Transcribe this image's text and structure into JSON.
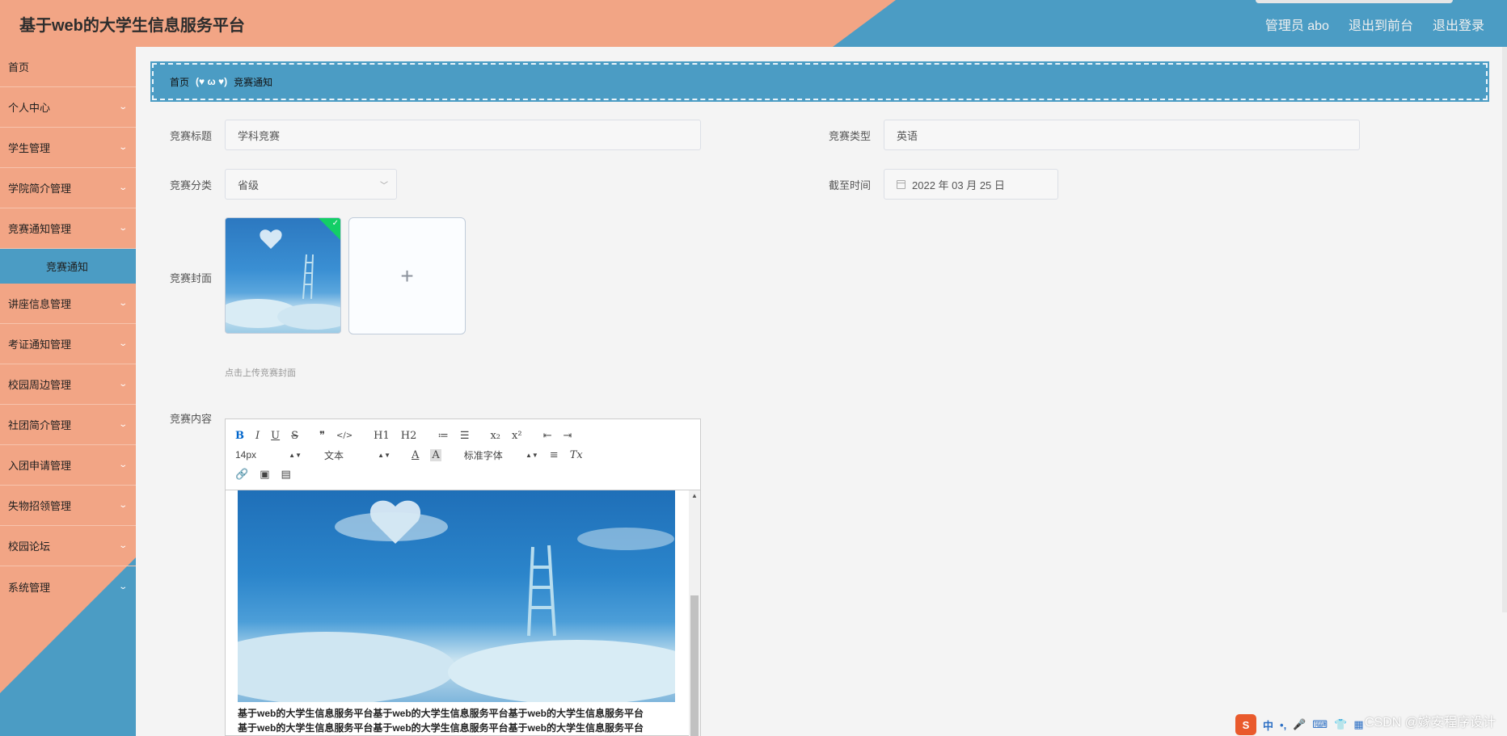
{
  "header": {
    "title": "基于web的大学生信息服务平台",
    "user": "管理员 abo",
    "front_link": "退出到前台",
    "logout": "退出登录"
  },
  "sidebar": {
    "items": [
      {
        "label": "首页",
        "has_arrow": false
      },
      {
        "label": "个人中心",
        "has_arrow": true
      },
      {
        "label": "学生管理",
        "has_arrow": true
      },
      {
        "label": "学院简介管理",
        "has_arrow": true
      },
      {
        "label": "竞赛通知管理",
        "has_arrow": true
      },
      {
        "label": "竞赛通知",
        "sub": true
      },
      {
        "label": "讲座信息管理",
        "has_arrow": true
      },
      {
        "label": "考证通知管理",
        "has_arrow": true
      },
      {
        "label": "校园周边管理",
        "has_arrow": true
      },
      {
        "label": "社团简介管理",
        "has_arrow": true
      },
      {
        "label": "入团申请管理",
        "has_arrow": true
      },
      {
        "label": "失物招领管理",
        "has_arrow": true
      },
      {
        "label": "校园论坛",
        "has_arrow": true
      },
      {
        "label": "系统管理",
        "has_arrow": true
      }
    ]
  },
  "breadcrumb": {
    "home": "首页",
    "separator": "(♥ ω ♥)",
    "current": "竞赛通知"
  },
  "form": {
    "title_label": "竞赛标题",
    "title_value": "学科竞赛",
    "type_label": "竞赛类型",
    "type_value": "英语",
    "category_label": "竞赛分类",
    "category_value": "省级",
    "deadline_label": "截至时间",
    "deadline_value": "2022 年 03 月 25 日",
    "cover_label": "竞赛封面",
    "cover_tip": "点击上传竞赛封面",
    "content_label": "竞赛内容"
  },
  "editor": {
    "toolbar_row1": [
      "B",
      "I",
      "U",
      "S",
      "❞",
      "</>",
      "H1",
      "H2",
      "≔",
      "☰",
      "x₂",
      "x²",
      "⇤",
      "⇥"
    ],
    "font_size": "14px",
    "block_type": "文本",
    "font_family": "标准字体",
    "content_text": "基于web的大学生信息服务平台基于web的大学生信息服务平台基于web的大学生信息服务平台\n基于web的大学生信息服务平台基于web的大学生信息服务平台基于web的大学生信息服务平台"
  },
  "watermark": "CSDN @嫁安程序设计",
  "ime": {
    "logo": "S",
    "lang": "中",
    "punct": "•,"
  },
  "colors": {
    "salmon": "#f2a585",
    "blue": "#4b9cc4",
    "success": "#13ce66"
  }
}
